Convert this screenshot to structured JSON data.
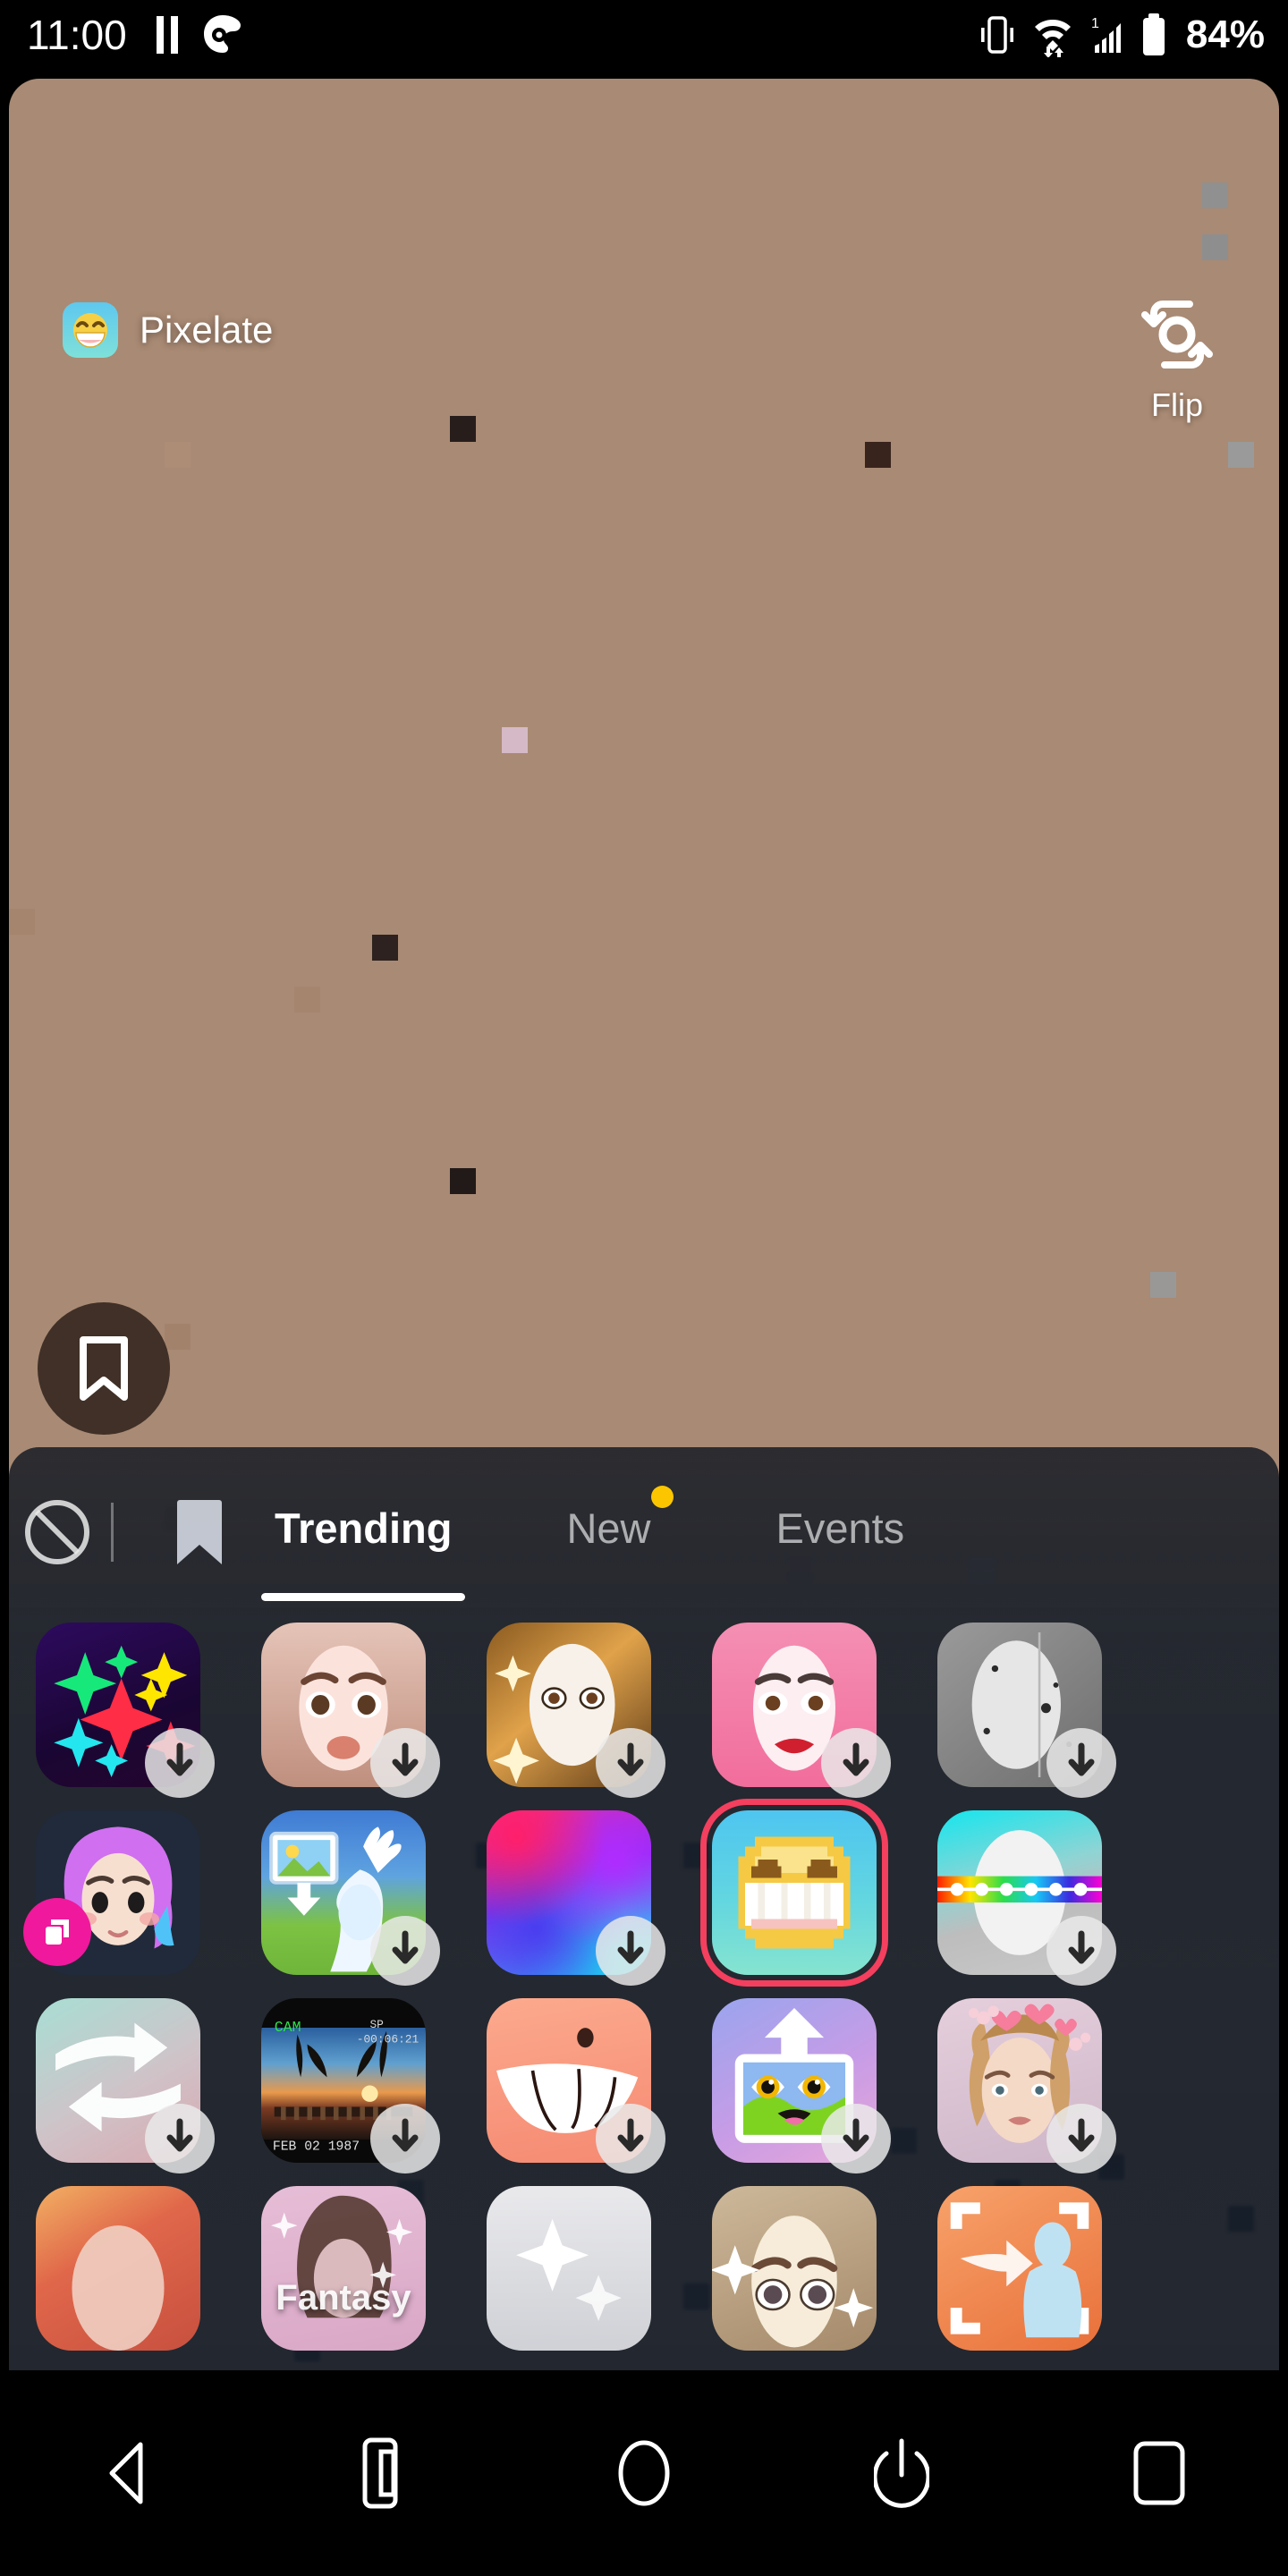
{
  "status_bar": {
    "time": "11:00",
    "battery_percent": "84%",
    "icons": [
      "pause-icon",
      "location-share-icon",
      "vibrate-icon",
      "wifi-icon",
      "signal-icon",
      "battery-icon"
    ]
  },
  "camera": {
    "active_filter_name": "Pixelate",
    "active_filter_icon": "grinning-face-icon",
    "flip_label": "Flip",
    "flip_icon": "camera-flip-icon",
    "bookmark_icon": "bookmark-icon"
  },
  "filter_panel": {
    "left_icons": [
      {
        "name": "no-filter-icon",
        "label": "None"
      },
      {
        "name": "bookmark-icon",
        "label": "Saved"
      }
    ],
    "tabs": [
      {
        "id": "trending",
        "label": "Trending",
        "active": true,
        "badge": false
      },
      {
        "id": "new",
        "label": "New",
        "active": false,
        "badge": true
      },
      {
        "id": "events",
        "label": "Events",
        "active": false,
        "badge": false
      }
    ],
    "badge_color": "#fbc600",
    "selection_color": "#f43f5e",
    "filters": [
      {
        "id": "sparkle-neon",
        "style": "sparkle-neon",
        "download": true,
        "new": false,
        "selected": false,
        "caption": ""
      },
      {
        "id": "freckle-doll",
        "style": "freckle-doll",
        "download": true,
        "new": false,
        "selected": false,
        "caption": ""
      },
      {
        "id": "golden-glow-mask",
        "style": "golden-glow-mask",
        "download": true,
        "new": false,
        "selected": false,
        "caption": ""
      },
      {
        "id": "pink-glam",
        "style": "pink-glam",
        "download": true,
        "new": false,
        "selected": false,
        "caption": ""
      },
      {
        "id": "grayscale-moon",
        "style": "grayscale-moon",
        "download": true,
        "new": false,
        "selected": false,
        "caption": ""
      },
      {
        "id": "pastel-hair-doll",
        "style": "pastel-hair-doll",
        "download": false,
        "new": true,
        "selected": false,
        "caption": ""
      },
      {
        "id": "photo-import",
        "style": "photo-import",
        "download": true,
        "new": false,
        "selected": false,
        "caption": ""
      },
      {
        "id": "aurora-gradient",
        "style": "aurora-gradient",
        "download": true,
        "new": false,
        "selected": false,
        "caption": ""
      },
      {
        "id": "pixelate",
        "style": "pixelate",
        "download": false,
        "new": false,
        "selected": true,
        "caption": ""
      },
      {
        "id": "rainbow-band",
        "style": "rainbow-band",
        "download": true,
        "new": false,
        "selected": false,
        "caption": ""
      },
      {
        "id": "swap-arrows",
        "style": "swap-arrows",
        "download": true,
        "new": false,
        "selected": false,
        "caption": ""
      },
      {
        "id": "retro-vhs",
        "style": "retro-vhs",
        "download": true,
        "new": false,
        "selected": false,
        "caption": "FEB 02 1987"
      },
      {
        "id": "big-smile",
        "style": "big-smile",
        "download": true,
        "new": false,
        "selected": false,
        "caption": ""
      },
      {
        "id": "big-eyes-upload",
        "style": "big-eyes-upload",
        "download": true,
        "new": false,
        "selected": false,
        "caption": ""
      },
      {
        "id": "heart-crown",
        "style": "heart-crown",
        "download": true,
        "new": false,
        "selected": false,
        "caption": ""
      },
      {
        "id": "peach-blur",
        "style": "peach-blur",
        "download": false,
        "new": false,
        "selected": false,
        "caption": ""
      },
      {
        "id": "fantasy",
        "style": "fantasy",
        "download": false,
        "new": false,
        "selected": false,
        "caption": "Fantasy"
      },
      {
        "id": "white-sparkle",
        "style": "white-sparkle",
        "download": false,
        "new": false,
        "selected": false,
        "caption": ""
      },
      {
        "id": "sparkle-eyes",
        "style": "sparkle-eyes",
        "download": false,
        "new": false,
        "selected": false,
        "caption": ""
      },
      {
        "id": "orange-body-track",
        "style": "orange-body-track",
        "download": false,
        "new": false,
        "selected": false,
        "caption": ""
      }
    ]
  },
  "nav_bar": {
    "buttons": [
      {
        "name": "back-button",
        "icon": "triangle-left-icon"
      },
      {
        "name": "screenshot-button",
        "icon": "phone-icon"
      },
      {
        "name": "home-button",
        "icon": "circle-icon"
      },
      {
        "name": "power-button",
        "icon": "power-icon"
      },
      {
        "name": "recents-button",
        "icon": "square-icon"
      }
    ]
  }
}
